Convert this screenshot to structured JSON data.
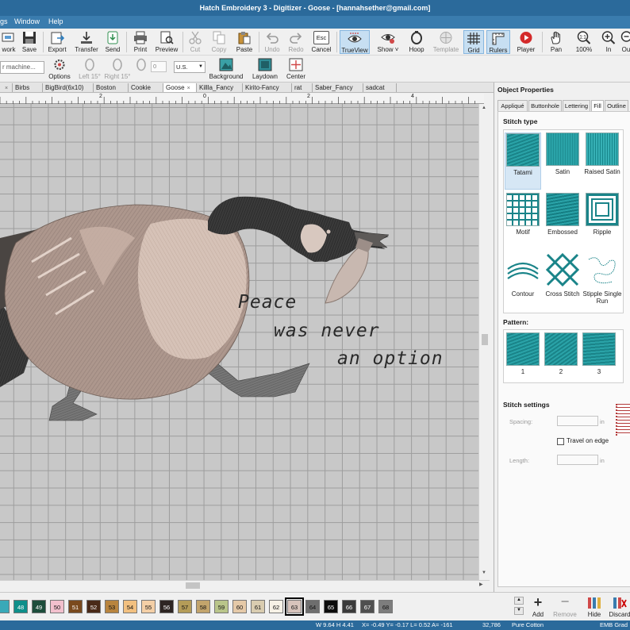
{
  "window": {
    "title": "Hatch Embroidery 3 - Digitizer - Goose - [hannahsether@gmail.com]"
  },
  "menu": {
    "items": [
      "gs",
      "Window",
      "Help"
    ]
  },
  "toolbar": {
    "network": "work",
    "save": "Save",
    "export": "Export",
    "transfer": "Transfer",
    "send": "Send",
    "print": "Print",
    "preview": "Preview",
    "cut": "Cut",
    "copy": "Copy",
    "paste": "Paste",
    "undo": "Undo",
    "redo": "Redo",
    "cancel": "Cancel",
    "esc_key": "Esc",
    "trueview": "TrueView",
    "show": "Show ˅",
    "hoop": "Hoop",
    "template": "Template",
    "grid": "Grid",
    "rulers": "Rulers",
    "player": "Player",
    "pan": "Pan",
    "zoom100": "100%",
    "zoom_in": "In",
    "zoom_out": "Ou"
  },
  "toolbar2": {
    "machine": "r machine...",
    "options": "Options",
    "left15": "Left 15°",
    "right15": "Right 15°",
    "angle_value": "0",
    "units": "U.S.",
    "background": "Background",
    "laydown": "Laydown",
    "center": "Center"
  },
  "doc_tabs": [
    "Birbs",
    "BigBird(6x10)",
    "Boston",
    "Cookie",
    "Goose",
    "Killla_Fancy",
    "Kirito-Fancy",
    "rat",
    "Saber_Fancy",
    "sadcat"
  ],
  "ruler": {
    "marks": [
      "2",
      "0",
      "2",
      "4"
    ]
  },
  "design": {
    "lines": [
      "Peace",
      "was never",
      "an option"
    ]
  },
  "panel": {
    "title": "Object Properties",
    "tabs": [
      "Appliqué",
      "Buttonhole",
      "Lettering",
      "Fill",
      "Outline"
    ],
    "stitch_type_label": "Stitch type",
    "stitch_types": [
      "Tatami",
      "Satin",
      "Raised Satin",
      "Motif",
      "Embossed",
      "Ripple",
      "Contour",
      "Cross Stitch",
      "Stipple Single Run"
    ],
    "pattern_label": "Pattern:",
    "patterns": [
      "1",
      "2",
      "3"
    ],
    "settings_label": "Stitch settings",
    "spacing_label": "Spacing:",
    "length_label": "Length:",
    "unit": "in",
    "travel_label": "Travel on edge"
  },
  "palette": {
    "chips": [
      {
        "n": "",
        "c": "#39a9b8"
      },
      {
        "n": "48",
        "c": "#0e8f8a"
      },
      {
        "n": "49",
        "c": "#1d4d3b"
      },
      {
        "n": "50",
        "c": "#f2c0cd"
      },
      {
        "n": "51",
        "c": "#7a4a1e"
      },
      {
        "n": "52",
        "c": "#4a2a18"
      },
      {
        "n": "53",
        "c": "#b8843e"
      },
      {
        "n": "54",
        "c": "#f2c080"
      },
      {
        "n": "55",
        "c": "#f4cfa6"
      },
      {
        "n": "56",
        "c": "#2d2523"
      },
      {
        "n": "57",
        "c": "#b49c58"
      },
      {
        "n": "58",
        "c": "#c2a46c"
      },
      {
        "n": "59",
        "c": "#b9c58a"
      },
      {
        "n": "60",
        "c": "#e5c9a8"
      },
      {
        "n": "61",
        "c": "#d9ccb0"
      },
      {
        "n": "62",
        "c": "#f6f1e6"
      },
      {
        "n": "63",
        "c": "#d7c3bb"
      },
      {
        "n": "64",
        "c": "#6e6e6e"
      },
      {
        "n": "65",
        "c": "#0d0d0d"
      },
      {
        "n": "66",
        "c": "#3a3a3a"
      },
      {
        "n": "67",
        "c": "#4f4f4f"
      },
      {
        "n": "68",
        "c": "#7d7d7d"
      }
    ],
    "add": "Add",
    "remove": "Remove",
    "hide": "Hide",
    "discard": "Discard"
  },
  "status": {
    "size": "W 9.64 H 4.41",
    "coords": "X= -0.49 Y= -0.17 L= 0.52 A= -161",
    "stitches": "32,786",
    "fabric": "Pure Cotton",
    "format": "EMB Grad"
  }
}
